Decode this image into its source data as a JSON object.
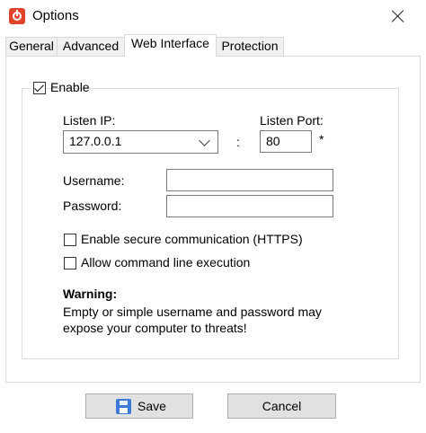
{
  "window": {
    "title": "Options",
    "icon": "power-icon"
  },
  "tabs": [
    {
      "label": "General"
    },
    {
      "label": "Advanced"
    },
    {
      "label": "Web Interface"
    },
    {
      "label": "Protection"
    }
  ],
  "active_tab": "Web Interface",
  "web": {
    "enable_label": "Enable",
    "enable_checked": true,
    "listen_ip_label": "Listen IP:",
    "listen_ip_value": "127.0.0.1",
    "listen_port_label": "Listen Port:",
    "port_separator": ":",
    "listen_port_value": "80",
    "port_required_marker": "*",
    "username_label": "Username:",
    "username_value": "",
    "password_label": "Password:",
    "password_value": "",
    "https_label": "Enable secure communication (HTTPS)",
    "https_checked": false,
    "cmdline_label": "Allow command line execution",
    "cmdline_checked": false,
    "warning_title": "Warning:",
    "warning_line1": "Empty or simple username and password may",
    "warning_line2": "expose your computer to threats!"
  },
  "buttons": {
    "save": "Save",
    "save_icon": "floppy-disk-icon",
    "cancel": "Cancel"
  }
}
